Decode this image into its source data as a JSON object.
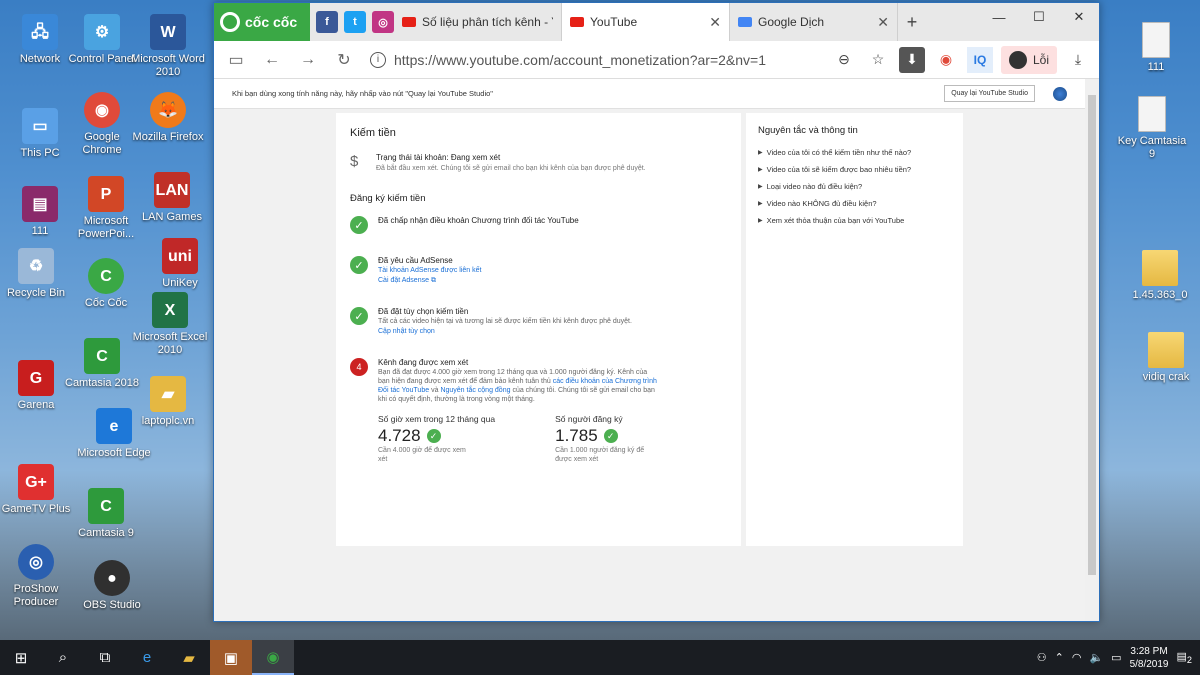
{
  "desktop_icons": [
    {
      "label": "Network",
      "icon": "network-icon",
      "color": "#3a88d8"
    },
    {
      "label": "Control Panel",
      "icon": "control-panel-icon",
      "color": "#4aa3e0"
    },
    {
      "label": "Microsoft Word 2010",
      "icon": "word-icon",
      "color": "#2b579a"
    },
    {
      "label": "This PC",
      "icon": "computer-icon",
      "color": "#5aa0e6"
    },
    {
      "label": "Google Chrome",
      "icon": "chrome-icon",
      "color": "#e04a3a"
    },
    {
      "label": "Mozilla Firefox",
      "icon": "firefox-icon",
      "color": "#f07a1a"
    },
    {
      "label": "111",
      "icon": "winrar-icon",
      "color": "#8a2a6a"
    },
    {
      "label": "Microsoft PowerPoi...",
      "icon": "powerpoint-icon",
      "color": "#d24726"
    },
    {
      "label": "LAN Games",
      "icon": "lan-games-icon",
      "color": "#c03028"
    },
    {
      "label": "Recycle Bin",
      "icon": "recycle-bin-icon",
      "color": "#9ab8d8"
    },
    {
      "label": "Cốc Cốc",
      "icon": "coccoc-icon",
      "color": "#3aa845"
    },
    {
      "label": "UniKey",
      "icon": "unikey-icon",
      "color": "#c02828"
    },
    {
      "label": "Microsoft Excel 2010",
      "icon": "excel-icon",
      "color": "#217346"
    },
    {
      "label": "Garena",
      "icon": "garena-icon",
      "color": "#c81e1e"
    },
    {
      "label": "Camtasia 2018",
      "icon": "camtasia-icon",
      "color": "#2e9a3c"
    },
    {
      "label": "laptoplc.vn",
      "icon": "folder-user-icon",
      "color": "#e5b842"
    },
    {
      "label": "Microsoft Edge",
      "icon": "edge-icon",
      "color": "#1e78d8"
    },
    {
      "label": "GameTV Plus",
      "icon": "gametv-icon",
      "color": "#e03030"
    },
    {
      "label": "Camtasia 9",
      "icon": "camtasia9-icon",
      "color": "#2e9a3c"
    },
    {
      "label": "ProShow Producer",
      "icon": "proshow-icon",
      "color": "#2a5fb0"
    },
    {
      "label": "OBS Studio",
      "icon": "obs-icon",
      "color": "#303030"
    },
    {
      "label": "111",
      "icon": "text-file-icon",
      "color": "#f4f4f4"
    },
    {
      "label": "Key Camtasia 9",
      "icon": "text-file-icon",
      "color": "#f4f4f4"
    },
    {
      "label": "1.45.363_0",
      "icon": "folder-icon",
      "color": "#e5b842"
    },
    {
      "label": "vidiq crak",
      "icon": "folder-icon",
      "color": "#e5b842"
    }
  ],
  "browser": {
    "brand": "cốc cốc",
    "tabs": [
      {
        "label": "Số liệu phân tích kênh - Yo",
        "color": "#e62117"
      },
      {
        "label": "YouTube",
        "color": "#e62117"
      },
      {
        "label": "Google Dịch",
        "color": "#4285f4"
      }
    ],
    "url": "https://www.youtube.com/account_monetization?ar=2&nv=1",
    "profile_label": "Lỗi",
    "iq_label": "IQ"
  },
  "notice": {
    "text": "Khi bạn dùng xong tính năng này, hãy nhấp vào nút \"Quay lại YouTube Studio\"",
    "button": "Quay lại YouTube Studio"
  },
  "monetization": {
    "title": "Kiếm tiền",
    "status_title": "Trạng thái tài khoản: Đang xem xét",
    "status_desc": "Đã bắt đầu xem xét. Chúng tôi sẽ gửi email cho bạn khi kênh của bạn được phê duyệt.",
    "signup_title": "Đăng ký kiếm tiền",
    "step1_title": "Đã chấp nhận điều khoản Chương trình đối tác YouTube",
    "step2_title": "Đã yêu cầu AdSense",
    "step2_link1": "Tài khoản AdSense được liên kết",
    "step2_link2": "Cài đặt Adsense",
    "step3_title": "Đã đặt tùy chọn kiếm tiền",
    "step3_desc": "Tất cả các video hiện tại và tương lai sẽ được kiếm tiền khi kênh được phê duyệt.",
    "step3_link": "Cập nhật tùy chọn",
    "step4_num": "4",
    "step4_title": "Kênh đang được xem xét",
    "step4_desc_a": "Bạn đã đạt được 4.000 giờ xem trong 12 tháng qua và 1.000 người đăng ký. Kênh của bạn hiện đang được xem xét để đảm bảo kênh tuân thủ",
    "step4_link_a": "các điều khoản của Chương trình Đối tác YouTube",
    "step4_desc_b": "và",
    "step4_link_b": "Nguyên tắc cộng đồng",
    "step4_desc_c": "của chúng tôi. Chúng tôi sẽ gửi email cho bạn khi có quyết định, thường là trong vòng một tháng.",
    "watch_label": "Số giờ xem trong 12 tháng qua",
    "watch_value": "4.728",
    "watch_sub": "Cần 4.000 giờ để được xem xét",
    "subs_label": "Số người đăng ký",
    "subs_value": "1.785",
    "subs_sub": "Cần 1.000 người đăng ký để được xem xét"
  },
  "guidelines": {
    "title": "Nguyên tắc và thông tin",
    "items": [
      "Video của tôi có thể kiếm tiền như thế nào?",
      "Video của tôi sẽ kiếm được bao nhiêu tiền?",
      "Loại video nào đủ điều kiện?",
      "Video nào KHÔNG đủ điều kiện?",
      "Xem xét thỏa thuận của bạn với YouTube"
    ]
  },
  "taskbar": {
    "time": "3:28 PM",
    "date": "5/8/2019",
    "notifications": "2"
  }
}
